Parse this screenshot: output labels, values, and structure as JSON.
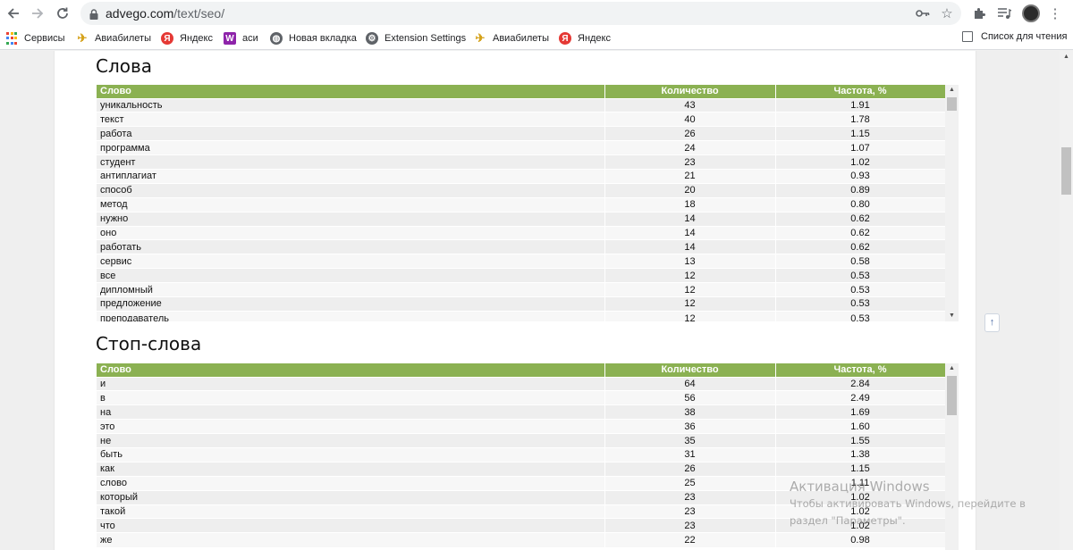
{
  "browser": {
    "url_host": "advego.com",
    "url_path": "/text/seo/",
    "bookmarks": [
      {
        "label": "Сервисы",
        "icon": "apps-grid-icon"
      },
      {
        "label": "Авиабилеты",
        "icon": "plane-icon"
      },
      {
        "label": "Яндекс",
        "icon": "yandex-icon"
      },
      {
        "label": "аси",
        "icon": "w-icon"
      },
      {
        "label": "Новая вкладка",
        "icon": "globe-icon"
      },
      {
        "label": "Extension Settings",
        "icon": "gear-icon"
      },
      {
        "label": "Авиабилеты",
        "icon": "plane-icon"
      },
      {
        "label": "Яндекс",
        "icon": "yandex-icon"
      }
    ],
    "reading_list": "Список для чтения"
  },
  "words": {
    "title": "Слова",
    "headers": [
      "Слово",
      "Количество",
      "Частота, %"
    ],
    "rows": [
      [
        "уникальность",
        "43",
        "1.91"
      ],
      [
        "текст",
        "40",
        "1.78"
      ],
      [
        "работа",
        "26",
        "1.15"
      ],
      [
        "программа",
        "24",
        "1.07"
      ],
      [
        "студент",
        "23",
        "1.02"
      ],
      [
        "антиплагиат",
        "21",
        "0.93"
      ],
      [
        "способ",
        "20",
        "0.89"
      ],
      [
        "метод",
        "18",
        "0.80"
      ],
      [
        "нужно",
        "14",
        "0.62"
      ],
      [
        "оно",
        "14",
        "0.62"
      ],
      [
        "работать",
        "14",
        "0.62"
      ],
      [
        "сервис",
        "13",
        "0.58"
      ],
      [
        "все",
        "12",
        "0.53"
      ],
      [
        "дипломный",
        "12",
        "0.53"
      ],
      [
        "предложение",
        "12",
        "0.53"
      ],
      [
        "преподаватель",
        "12",
        "0.53"
      ]
    ]
  },
  "stopwords": {
    "title": "Стоп-слова",
    "headers": [
      "Слово",
      "Количество",
      "Частота, %"
    ],
    "rows": [
      [
        "и",
        "64",
        "2.84"
      ],
      [
        "в",
        "56",
        "2.49"
      ],
      [
        "на",
        "38",
        "1.69"
      ],
      [
        "это",
        "36",
        "1.60"
      ],
      [
        "не",
        "35",
        "1.55"
      ],
      [
        "быть",
        "31",
        "1.38"
      ],
      [
        "как",
        "26",
        "1.15"
      ],
      [
        "слово",
        "25",
        "1.11"
      ],
      [
        "который",
        "23",
        "1.02"
      ],
      [
        "такой",
        "23",
        "1.02"
      ],
      [
        "что",
        "23",
        "1.02"
      ],
      [
        "же",
        "22",
        "0.98"
      ]
    ]
  },
  "watermark": {
    "title": "Активация Windows",
    "line1": "Чтобы активировать Windows, перейдите в",
    "line2": "раздел \"Параметры\"."
  },
  "colors": {
    "header_bg": "#8bb152",
    "row_odd": "#eeeeee",
    "row_even": "#f7f7f7"
  }
}
